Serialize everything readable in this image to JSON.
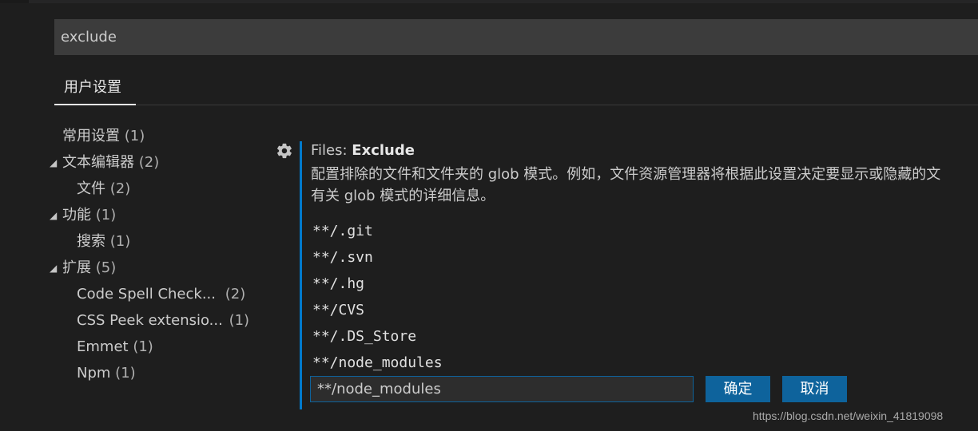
{
  "search": {
    "value": "exclude"
  },
  "tabs": [
    {
      "label": "用户设置"
    }
  ],
  "toc": {
    "items": [
      {
        "label": "常用设置",
        "count": "(1)",
        "expanded": null
      },
      {
        "label": "文本编辑器",
        "count": "(2)",
        "expanded": true
      },
      {
        "label": "文件",
        "count": "(2)",
        "expanded": null
      },
      {
        "label": "功能",
        "count": "(1)",
        "expanded": true
      },
      {
        "label": "搜索",
        "count": "(1)",
        "expanded": null
      },
      {
        "label": "扩展",
        "count": "(5)",
        "expanded": true
      },
      {
        "label": "Code Spell Check...",
        "count": "(2)",
        "expanded": null
      },
      {
        "label": "CSS Peek extensio...",
        "count": "(1)",
        "expanded": null
      },
      {
        "label": "Emmet",
        "count": "(1)",
        "expanded": null
      },
      {
        "label": "Npm",
        "count": "(1)",
        "expanded": null
      }
    ]
  },
  "setting": {
    "category": "Files: ",
    "name": "Exclude",
    "description_line1": "配置排除的文件和文件夹的 glob 模式。例如，文件资源管理器将根据此设置决定要显示或隐藏的文",
    "description_line2": "有关 glob 模式的详细信息。",
    "patterns": [
      "**/.git",
      "**/.svn",
      "**/.hg",
      "**/CVS",
      "**/.DS_Store",
      "**/node_modules"
    ],
    "edit_value": "**/node_modules",
    "ok_label": "确定",
    "cancel_label": "取消"
  },
  "watermark": "https://blog.csdn.net/weixin_41819098",
  "colors": {
    "accent": "#007acc",
    "button": "#0e639c",
    "background": "#1e1e1e",
    "input": "#3c3c3c"
  },
  "icons": {
    "setting": "gear-icon",
    "expand": "caret-down-icon"
  }
}
